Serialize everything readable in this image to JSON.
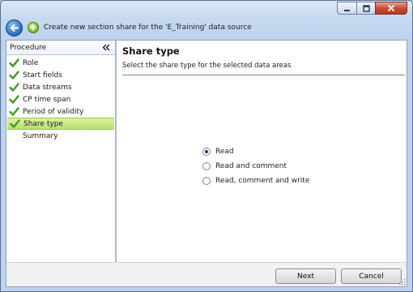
{
  "window": {
    "title": "Create new section share for the 'E_Training' data source"
  },
  "procedure": {
    "header": "Procedure",
    "steps": [
      {
        "label": "Role",
        "state": "done"
      },
      {
        "label": "Start fields",
        "state": "done"
      },
      {
        "label": "Data streams",
        "state": "done"
      },
      {
        "label": "CP time span",
        "state": "done"
      },
      {
        "label": "Period of validity",
        "state": "done"
      },
      {
        "label": "Share type",
        "state": "active"
      },
      {
        "label": "Summary",
        "state": "pending"
      }
    ]
  },
  "main": {
    "title": "Share type",
    "subtitle": "Select the share type for the selected data areas",
    "options": [
      {
        "label": "Read",
        "checked": true
      },
      {
        "label": "Read and comment",
        "checked": false
      },
      {
        "label": "Read, comment and write",
        "checked": false
      }
    ]
  },
  "footer": {
    "next_label": "Next",
    "cancel_label": "Cancel"
  },
  "colors": {
    "active_step": "#c4e67f",
    "check_green": "#3f9a1e",
    "title_rule": "#5ea35e"
  },
  "icons": {
    "back": "back-arrow-icon",
    "wizard": "wizard-icon",
    "collapse": "double-chevron-left-icon",
    "step_done": "checkmark-icon"
  }
}
